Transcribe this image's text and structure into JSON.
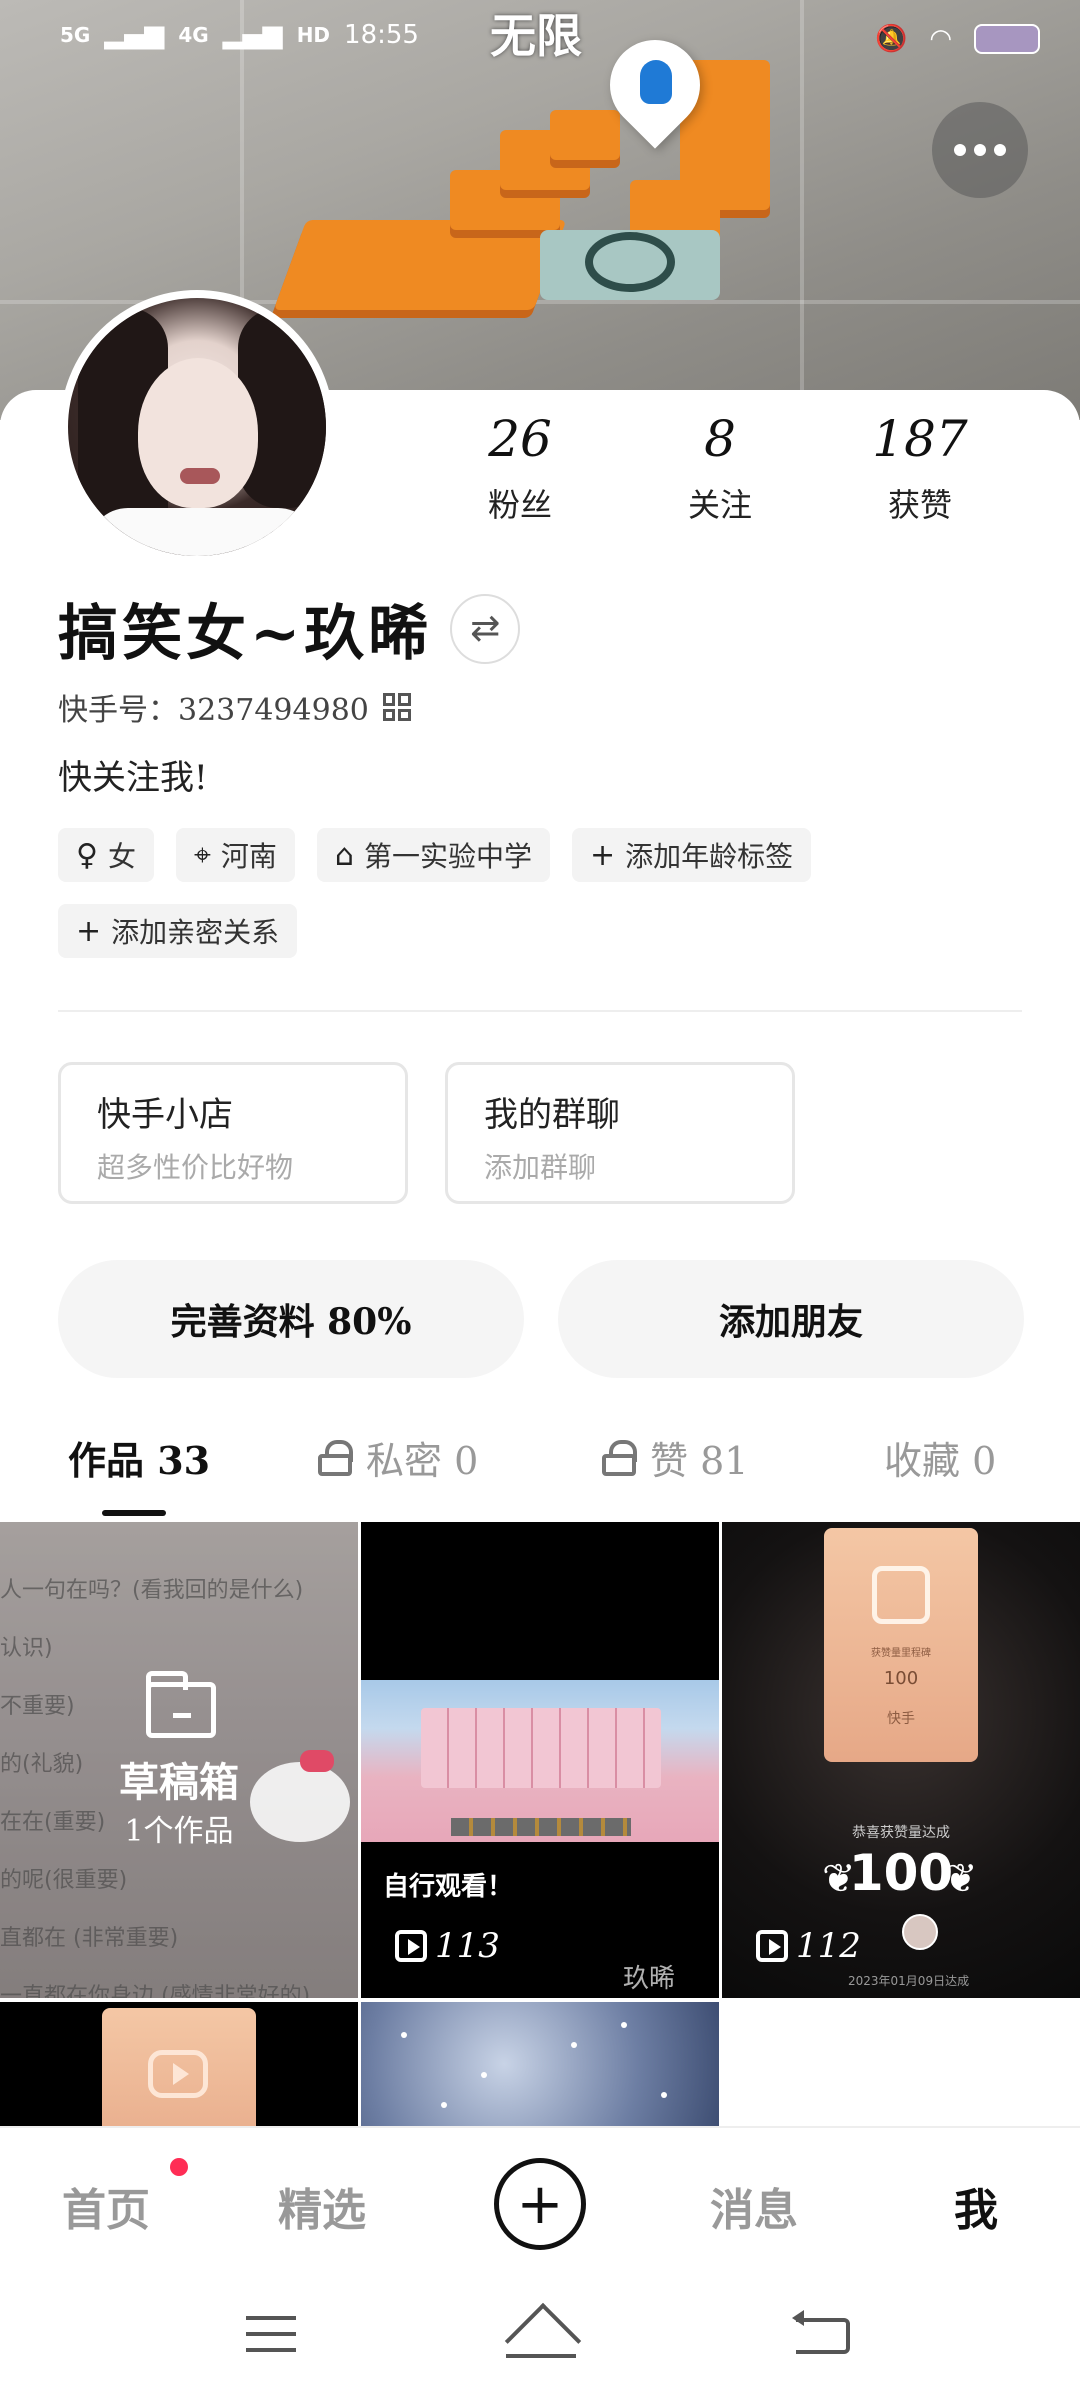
{
  "status": {
    "signal1": "5G",
    "signal2": "4G",
    "hd": "HD",
    "time": "18:55"
  },
  "banner": {
    "game_title": "无限"
  },
  "profile": {
    "stats": [
      {
        "value": "26",
        "label": "粉丝"
      },
      {
        "value": "8",
        "label": "关注"
      },
      {
        "value": "187",
        "label": "获赞"
      }
    ],
    "name": "搞笑女~玖晞",
    "kuaishou_id": "快手号：3237494980",
    "bio": "快关注我!",
    "tags": [
      {
        "icon": "gender-female-icon",
        "label": "女"
      },
      {
        "icon": "location-icon",
        "label": "河南"
      },
      {
        "icon": "school-icon",
        "label": "第一实验中学"
      },
      {
        "icon": "plus-icon",
        "label": "添加年龄标签"
      },
      {
        "icon": "plus-icon",
        "label": "添加亲密关系"
      }
    ]
  },
  "cards": {
    "shop": {
      "title": "快手小店",
      "subtitle": "超多性价比好物"
    },
    "group": {
      "title": "我的群聊",
      "subtitle": "添加群聊"
    }
  },
  "actions": {
    "complete": "完善资料 80%",
    "add_friend": "添加朋友"
  },
  "tabs": [
    {
      "label": "作品 33"
    },
    {
      "label": "私密 0"
    },
    {
      "label": "赞 81"
    },
    {
      "label": "收藏 0"
    }
  ],
  "grid": {
    "draft": {
      "title": "草稿箱",
      "subtitle": "1个作品"
    },
    "draft_bg_lines": [
      "人一句在吗？(看我回的是什么)",
      "认识)",
      "不重要)",
      "的(礼貌)",
      "在在(重要)",
      "的呢(很重要)",
      "直都在 (非常重要)",
      "一直都在你身边 (感情非常好的)"
    ],
    "video2": {
      "caption": "自行观看！",
      "plays": "113",
      "watermark": "玖晞"
    },
    "video3": {
      "plays": "112",
      "plaque_top": "获赞量里程碑",
      "plaque_value": "100",
      "plaque_brand": "快手",
      "achieved": "恭喜获赞量达成",
      "big": "100",
      "date": "2023年01月09日达成"
    }
  },
  "bottom_nav": {
    "home": "首页",
    "featured": "精选",
    "messages": "消息",
    "me": "我"
  }
}
